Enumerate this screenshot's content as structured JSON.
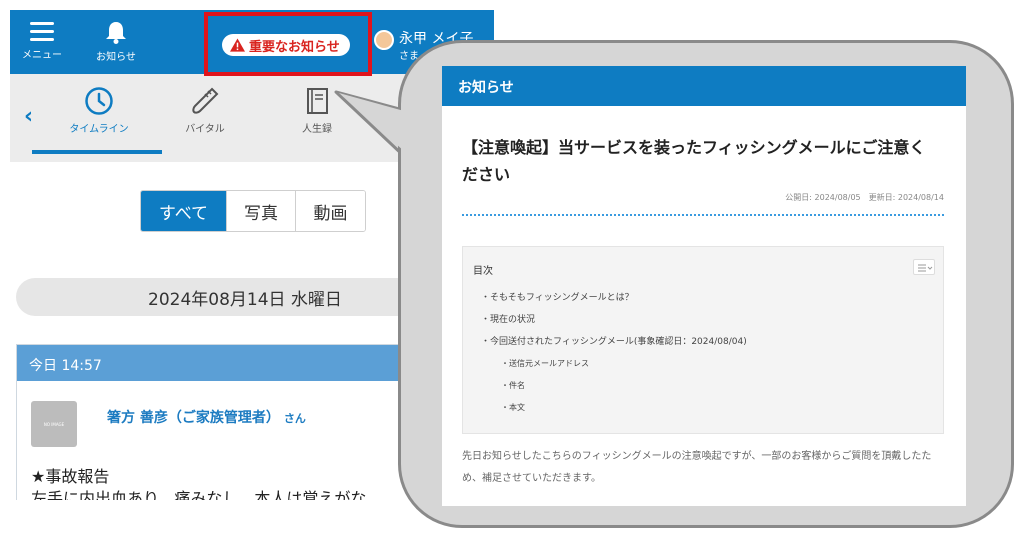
{
  "header": {
    "menu_label": "メニュー",
    "bell_label": "お知らせ",
    "notice_button": "重要なお知らせ",
    "user_name": "永甲 メイ子",
    "user_suffix": "さま"
  },
  "subnav": {
    "items": [
      {
        "label": "タイムライン",
        "icon": "clock-icon",
        "active": true
      },
      {
        "label": "バイタル",
        "icon": "thermometer-icon",
        "active": false
      },
      {
        "label": "人生録",
        "icon": "book-icon",
        "active": false
      }
    ]
  },
  "filter": {
    "options": [
      "すべて",
      "写真",
      "動画"
    ],
    "selected": "すべて"
  },
  "timeline": {
    "date": "2024年08月14日 水曜日",
    "card": {
      "time": "今日 14:57",
      "thumb_text": "NO IMAGE",
      "author": "箸方 善彦（ご家族管理者）",
      "author_suffix": "さん",
      "title": "★事故報告",
      "body": "左手に内出血あり、痛みなし。本人は覚えがな"
    }
  },
  "notice_panel": {
    "header": "お知らせ",
    "title": "【注意喚起】当サービスを装ったフィッシングメールにご注意ください",
    "published": "公開日: 2024/08/05",
    "updated": "更新日: 2024/08/14",
    "toc_title": "目次",
    "toc": [
      {
        "text": "・そもそもフィッシングメールとは？",
        "level": 1
      },
      {
        "text": "・現在の状況",
        "level": 1
      },
      {
        "text": "・今回送付されたフィッシングメール(事象確認日：2024/08/04)",
        "level": 1
      },
      {
        "text": "・送信元メールアドレス",
        "level": 2
      },
      {
        "text": "・件名",
        "level": 2
      },
      {
        "text": "・本文",
        "level": 2
      }
    ],
    "lead": "先日お知らせしたこちらのフィッシングメールの注意喚起ですが、一部のお客様からご質問を頂戴したため、補足させていただきます。"
  },
  "colors": {
    "brand_blue": "#0e7cc2",
    "highlight_red": "#e0141c",
    "card_header_blue": "#5b9fd6"
  }
}
